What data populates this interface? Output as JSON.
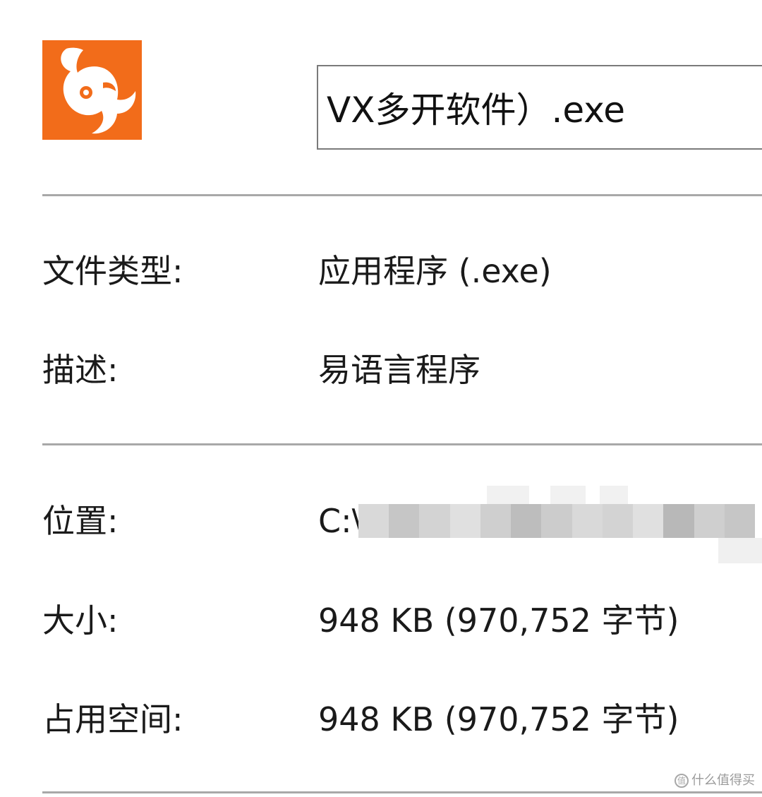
{
  "header": {
    "file_name": "VX多开软件）.exe",
    "icon": "orange-app-icon"
  },
  "properties": {
    "group1": [
      {
        "label": "文件类型:",
        "value": "应用程序 (.exe)"
      },
      {
        "label": "描述:",
        "value": "易语言程序"
      }
    ],
    "group2": [
      {
        "label": "位置:",
        "value": "C:\\"
      },
      {
        "label": "大小:",
        "value": "948 KB (970,752 字节)"
      },
      {
        "label": "占用空间:",
        "value": "948 KB (970,752 字节)"
      }
    ]
  },
  "watermark": {
    "text": "什么值得买",
    "icon": "value-badge-icon"
  },
  "colors": {
    "icon_bg": "#f26c1a",
    "divider": "#a8a8a8",
    "text": "#1a1a1a"
  }
}
